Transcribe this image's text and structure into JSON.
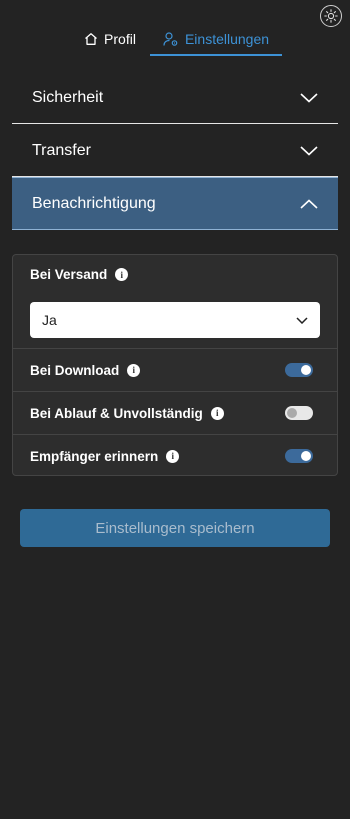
{
  "tabs": [
    {
      "label": "Profil",
      "icon": "home-icon"
    },
    {
      "label": "Einstellungen",
      "icon": "user-settings-icon",
      "active": true
    }
  ],
  "theme_toggle": {
    "icon": "sun-icon"
  },
  "accordion": [
    {
      "label": "Sicherheit",
      "expanded": false
    },
    {
      "label": "Transfer",
      "expanded": false
    },
    {
      "label": "Benachrichtigung",
      "expanded": true
    }
  ],
  "notifications": {
    "bei_versand": {
      "label": "Bei Versand",
      "value": "Ja"
    },
    "settings": [
      {
        "label": "Bei Download",
        "on": true
      },
      {
        "label": "Bei Ablauf & Unvollständig",
        "on": false
      },
      {
        "label": "Empfänger erinnern",
        "on": true
      }
    ]
  },
  "save_label": "Einstellungen speichern",
  "colors": {
    "accent": "#3d92d6",
    "active_section": "#3c5f82",
    "save_button": "#2f6a96",
    "background": "#232323"
  }
}
